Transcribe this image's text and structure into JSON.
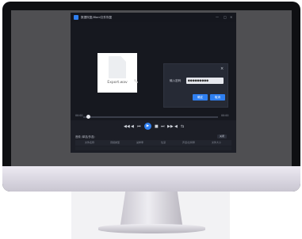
{
  "app": {
    "title": "数据恢复/Word文件恢复",
    "window_controls": {
      "minimize": "—",
      "maximize": "□",
      "close": "×"
    }
  },
  "preview": {
    "file_name": "Export.wav"
  },
  "dialog": {
    "close_glyph": "×",
    "password_label": "输入密码",
    "password_value": "●●●●●●●●●",
    "ok_label": "确定",
    "cancel_label": "取消"
  },
  "player": {
    "time_current": "00:00",
    "time_total": "00:00",
    "controls": [
      "◀◀",
      "◀",
      "⏮",
      "▶",
      "■",
      "⏭",
      "▶▶",
      "◀",
      "⇆"
    ]
  },
  "list": {
    "header": "音频 (单选/多选)",
    "close_label": "关闭",
    "columns": [
      "文件名称",
      "音频类型",
      "采样率",
      "位深",
      "声道/比特率",
      "文件大小"
    ]
  },
  "colors": {
    "accent": "#2f7ff0",
    "window_bg": "#1c1e26",
    "bezel": "#0e0f12"
  }
}
